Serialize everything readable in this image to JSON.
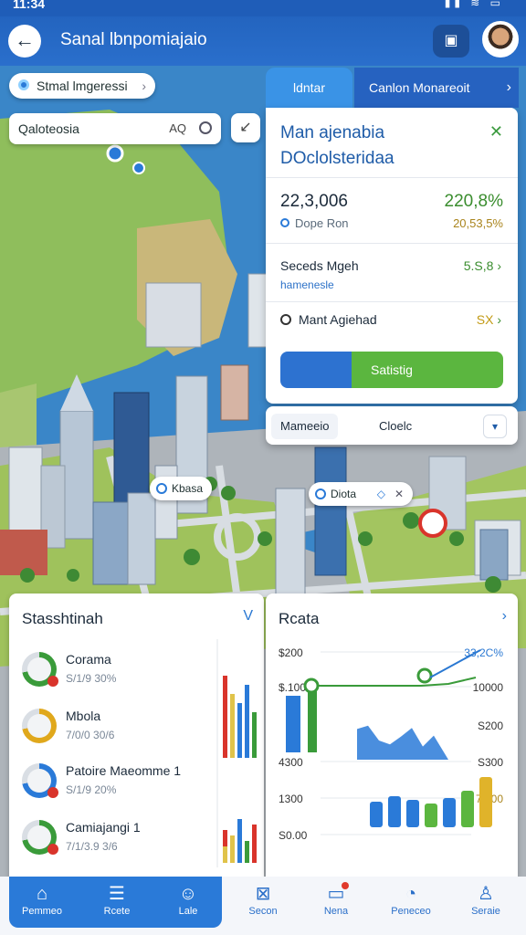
{
  "status_bar": {
    "time": "11:34",
    "icons": "▮▮ ≋ ▭"
  },
  "header": {
    "title": "Sanal lbnpomiajaio",
    "back_icon": "arrow-left-icon",
    "action_icon": "screen-icon"
  },
  "location_chip": {
    "label": "Stmal lmgeressi"
  },
  "tabs": [
    {
      "label": "ldntar",
      "active": true
    },
    {
      "label": "Canlon Monareoit",
      "active": false
    }
  ],
  "search": {
    "value": "Qaloteosia",
    "suffix": "AQ"
  },
  "map": {
    "labels": [
      {
        "text": "Kbasa"
      },
      {
        "text": "Diota"
      }
    ]
  },
  "info_panel": {
    "title_line1": "Man ajenabia",
    "title_line2": "DOclolsteridaa",
    "primary_value": "22,3,006",
    "primary_change": "220,8%",
    "sub_label": "Dope Ron",
    "sub_value": "20,53,5%",
    "row1_label": "Seceds Mgeh",
    "row1_sub": "hamenesle",
    "row1_value": "5.S,8",
    "row2_label": "Mant Agiehad",
    "row2_value": "SX",
    "button_label": "Satistig",
    "footer_a": "Mameeio",
    "footer_b": "Cloelc"
  },
  "stats_card": {
    "title": "Stasshtinah",
    "link": "V",
    "items": [
      {
        "name": "Corama",
        "value": "S/1/9 30%",
        "ring": "#3a9b3a"
      },
      {
        "name": "Mbola",
        "value": "7/0/0 30/6",
        "ring": "#e0a81c"
      },
      {
        "name": "Patoire Maeomme 1",
        "value": "S/1/9 20%",
        "ring": "#2a7ad8"
      },
      {
        "name": "Camiajangi 1",
        "value": "7/1/3.9 3/6",
        "ring": "#3a9b3a"
      }
    ],
    "mini_chart": {
      "type": "bar",
      "colors": [
        "#3a9b3a",
        "#d9342b",
        "#e0c34a",
        "#2a7ad8"
      ],
      "values_top": [
        3,
        6,
        4,
        8,
        5,
        9,
        7,
        6
      ],
      "values_bottom": [
        6,
        5,
        8,
        4,
        7,
        3
      ]
    }
  },
  "chart_card": {
    "title": "Rcata",
    "link": "›",
    "chart_data": {
      "type": "bar",
      "left_ticks": [
        "$200",
        "$.100",
        "4300",
        "1300",
        "S0.00"
      ],
      "right_ticks": [
        "33,2C%",
        "10000",
        "S200",
        "S300",
        "7,300"
      ],
      "series": [
        {
          "values": [
            56,
            62,
            35,
            28,
            42,
            58,
            24,
            44,
            70,
            88
          ]
        }
      ],
      "line_values": [
        71,
        71,
        71,
        71,
        71,
        73,
        80
      ]
    }
  },
  "bottom_nav": [
    {
      "label": "Pemmeo",
      "icon": "home-icon",
      "active": true
    },
    {
      "label": "Rcete",
      "icon": "list-icon",
      "active": true
    },
    {
      "label": "Lale",
      "icon": "user-icon",
      "active": true
    },
    {
      "label": "Secon",
      "icon": "cube-icon",
      "active": false
    },
    {
      "label": "Nena",
      "icon": "message-icon",
      "active": false,
      "dot": true
    },
    {
      "label": "Peneceo",
      "icon": "ear-icon",
      "active": false
    },
    {
      "label": "Seraie",
      "icon": "profile-icon",
      "active": false
    }
  ],
  "colors": {
    "primary": "#2a7ad8",
    "header": "#2364bf",
    "accent_green": "#3a8d2e",
    "accent_gold": "#c29a14"
  }
}
